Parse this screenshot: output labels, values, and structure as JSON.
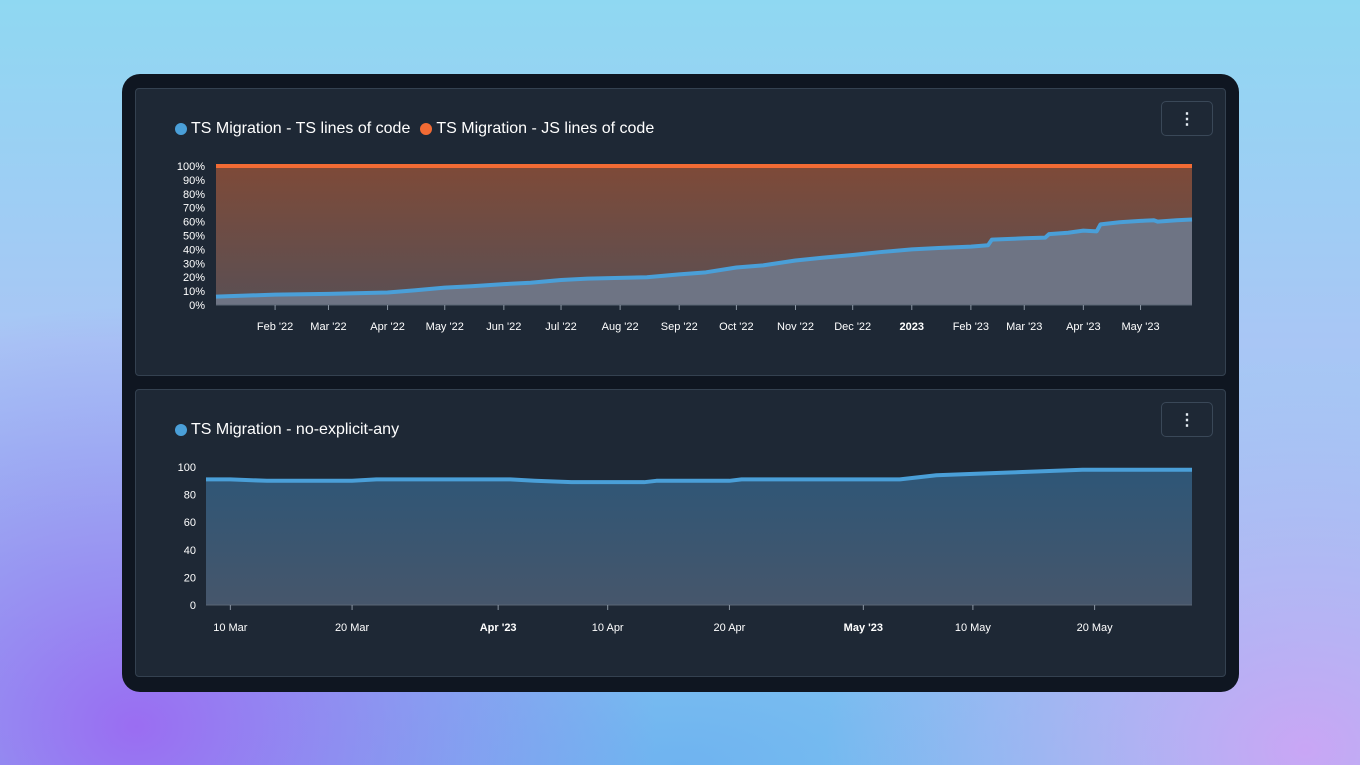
{
  "chart_data": [
    {
      "type": "area",
      "stacked_percent": true,
      "legend_position": "top-left",
      "x_tick_labels": [
        "Feb '22",
        "Mar '22",
        "Apr '22",
        "May '22",
        "Jun '22",
        "Jul '22",
        "Aug '22",
        "Sep '22",
        "Oct '22",
        "Nov '22",
        "Dec '22",
        "2023",
        "Feb '23",
        "Mar '23",
        "Apr '23",
        "May '23"
      ],
      "x_tick_bold": [
        false,
        false,
        false,
        false,
        false,
        false,
        false,
        false,
        false,
        false,
        false,
        true,
        false,
        false,
        false,
        false
      ],
      "y_tick_labels": [
        "100%",
        "90%",
        "80%",
        "70%",
        "60%",
        "50%",
        "40%",
        "30%",
        "20%",
        "10%",
        "0%"
      ],
      "ylim": [
        0,
        100
      ],
      "x": [
        "2022-01-01",
        "2022-02-01",
        "2022-03-01",
        "2022-04-01",
        "2022-04-15",
        "2022-05-01",
        "2022-05-15",
        "2022-06-01",
        "2022-06-15",
        "2022-07-01",
        "2022-07-15",
        "2022-08-01",
        "2022-08-15",
        "2022-09-01",
        "2022-09-15",
        "2022-10-01",
        "2022-10-15",
        "2022-11-01",
        "2022-11-15",
        "2022-12-01",
        "2022-12-15",
        "2023-01-01",
        "2023-01-15",
        "2023-02-01",
        "2023-02-10",
        "2023-02-12",
        "2023-03-01",
        "2023-03-12",
        "2023-03-14",
        "2023-03-24",
        "2023-04-01",
        "2023-04-08",
        "2023-04-10",
        "2023-04-20",
        "2023-05-01",
        "2023-05-08",
        "2023-05-10",
        "2023-05-20",
        "2023-05-28"
      ],
      "series": [
        {
          "name": "TS Migration - TS lines of code",
          "color": "#4a9fd8",
          "values": [
            6,
            7.5,
            8,
            9,
            10.5,
            12.5,
            13.5,
            15,
            16,
            18,
            19,
            19.5,
            20,
            22,
            23.5,
            27,
            28.5,
            32,
            34,
            36,
            38,
            40,
            41,
            42,
            43,
            47,
            48,
            48.5,
            51,
            52,
            53.5,
            53,
            58,
            59.5,
            60.5,
            61,
            60,
            61,
            61.5
          ]
        },
        {
          "name": "TS Migration - JS lines of code",
          "color": "#f26b34",
          "values": [
            94,
            92.5,
            92,
            91,
            89.5,
            87.5,
            86.5,
            85,
            84,
            82,
            81,
            80.5,
            80,
            78,
            76.5,
            73,
            71.5,
            68,
            66,
            64,
            62,
            60,
            59,
            58,
            57,
            53,
            52,
            51.5,
            49,
            48,
            46.5,
            47,
            42,
            40.5,
            39.5,
            39,
            40,
            39,
            38.5
          ]
        }
      ]
    },
    {
      "type": "area",
      "legend_position": "top-left",
      "x_tick_labels": [
        "10 Mar",
        "20 Mar",
        "Apr '23",
        "10 Apr",
        "20 Apr",
        "May '23",
        "10 May",
        "20 May"
      ],
      "x_tick_bold": [
        false,
        false,
        true,
        false,
        false,
        true,
        false,
        false
      ],
      "y_tick_labels": [
        "100",
        "80",
        "60",
        "40",
        "20",
        "0"
      ],
      "ylim": [
        0,
        100
      ],
      "x": [
        "2023-03-08",
        "2023-03-10",
        "2023-03-13",
        "2023-03-16",
        "2023-03-20",
        "2023-03-22",
        "2023-03-25",
        "2023-03-28",
        "2023-03-31",
        "2023-04-02",
        "2023-04-04",
        "2023-04-07",
        "2023-04-10",
        "2023-04-13",
        "2023-04-14",
        "2023-04-17",
        "2023-04-20",
        "2023-04-21",
        "2023-04-25",
        "2023-04-28",
        "2023-05-01",
        "2023-05-04",
        "2023-05-07",
        "2023-05-10",
        "2023-05-13",
        "2023-05-16",
        "2023-05-19",
        "2023-05-22",
        "2023-05-25",
        "2023-05-28"
      ],
      "series": [
        {
          "name": "TS Migration - no-explicit-any",
          "color": "#4a9fd8",
          "values": [
            91,
            91,
            90,
            90,
            90,
            91,
            91,
            91,
            91,
            91,
            90,
            89,
            89,
            89,
            90,
            90,
            90,
            91,
            91,
            91,
            91,
            91,
            94,
            95,
            96,
            97,
            98,
            98,
            98,
            98
          ]
        }
      ]
    }
  ],
  "panels": [
    {
      "legend": [
        {
          "label": "TS Migration - TS lines of code",
          "color": "#4a9fd8"
        },
        {
          "label": "TS Migration - JS lines of code",
          "color": "#f26b34"
        }
      ],
      "menu_label": "⋮"
    },
    {
      "legend": [
        {
          "label": "TS Migration - no-explicit-any",
          "color": "#4a9fd8"
        }
      ],
      "menu_label": "⋮"
    }
  ]
}
